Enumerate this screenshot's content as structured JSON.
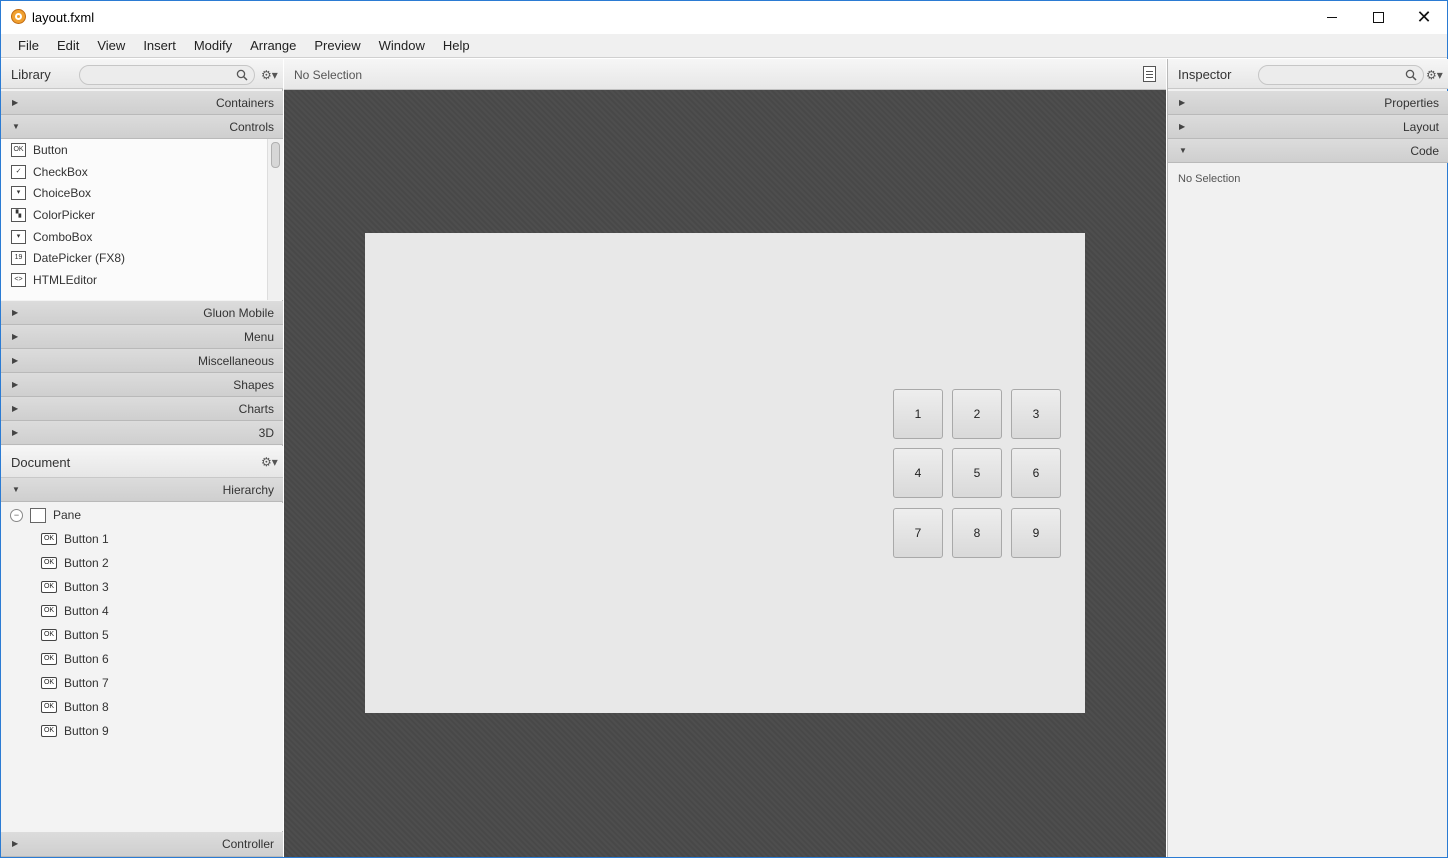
{
  "window": {
    "title": "layout.fxml"
  },
  "menu": [
    "File",
    "Edit",
    "View",
    "Insert",
    "Modify",
    "Arrange",
    "Preview",
    "Window",
    "Help"
  ],
  "library": {
    "title": "Library",
    "search_placeholder": "",
    "sections_top": [
      {
        "label": "Containers",
        "expanded": false
      },
      {
        "label": "Controls",
        "expanded": true
      }
    ],
    "controls": [
      {
        "label": "Button",
        "icon": "ok-button-icon",
        "glyph": "OK"
      },
      {
        "label": "CheckBox",
        "icon": "checkbox-icon",
        "glyph": "✓"
      },
      {
        "label": "ChoiceBox",
        "icon": "choicebox-icon",
        "glyph": "▾"
      },
      {
        "label": "ColorPicker",
        "icon": "colorpicker-icon",
        "glyph": "▚"
      },
      {
        "label": "ComboBox",
        "icon": "combobox-icon",
        "glyph": "▾"
      },
      {
        "label": "DatePicker  (FX8)",
        "icon": "datepicker-icon",
        "glyph": "19"
      },
      {
        "label": "HTMLEditor",
        "icon": "htmleditor-icon",
        "glyph": "<>"
      }
    ],
    "sections_bottom": [
      {
        "label": "Gluon Mobile"
      },
      {
        "label": "Menu"
      },
      {
        "label": "Miscellaneous"
      },
      {
        "label": "Shapes"
      },
      {
        "label": "Charts"
      },
      {
        "label": "3D"
      }
    ]
  },
  "document": {
    "title": "Document",
    "hierarchy_label": "Hierarchy",
    "root": "Pane",
    "children": [
      "Button  1",
      "Button  2",
      "Button  3",
      "Button  4",
      "Button  5",
      "Button  6",
      "Button  7",
      "Button  8",
      "Button  9"
    ],
    "controller_label": "Controller"
  },
  "canvas": {
    "selection_text": "No Selection",
    "buttons": [
      "1",
      "2",
      "3",
      "4",
      "5",
      "6",
      "7",
      "8",
      "9"
    ]
  },
  "inspector": {
    "title": "Inspector",
    "sections": [
      {
        "label": "Properties",
        "expanded": false
      },
      {
        "label": "Layout",
        "expanded": false
      },
      {
        "label": "Code",
        "expanded": true
      }
    ],
    "content_text": "No Selection"
  }
}
